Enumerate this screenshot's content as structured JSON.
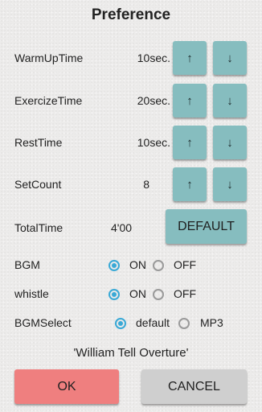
{
  "title": "Preference",
  "rows": [
    {
      "label": "WarmUpTime",
      "value": "10sec.",
      "up": "↑",
      "down": "↓"
    },
    {
      "label": "ExercizeTime",
      "value": "20sec.",
      "up": "↑",
      "down": "↓"
    },
    {
      "label": "RestTime",
      "value": "10sec.",
      "up": "↑",
      "down": "↓"
    },
    {
      "label": "SetCount",
      "value": "8",
      "up": "↑",
      "down": "↓"
    }
  ],
  "total": {
    "label": "TotalTime",
    "value": "4'00",
    "default_label": "DEFAULT"
  },
  "bgm": {
    "label": "BGM",
    "on": "ON",
    "off": "OFF",
    "selected": "ON"
  },
  "whistle": {
    "label": "whistle",
    "on": "ON",
    "off": "OFF",
    "selected": "ON"
  },
  "bgm_select": {
    "label": "BGMSelect",
    "default": "default",
    "mp3": "MP3",
    "selected": "default"
  },
  "song": "'William Tell Overture'",
  "buttons": {
    "ok": "OK",
    "cancel": "CANCEL"
  },
  "colors": {
    "arrow": "#86bdbf",
    "ok": "#ef7f7f",
    "cancel": "#cfcfcf",
    "radio": "#3aa9d6"
  }
}
